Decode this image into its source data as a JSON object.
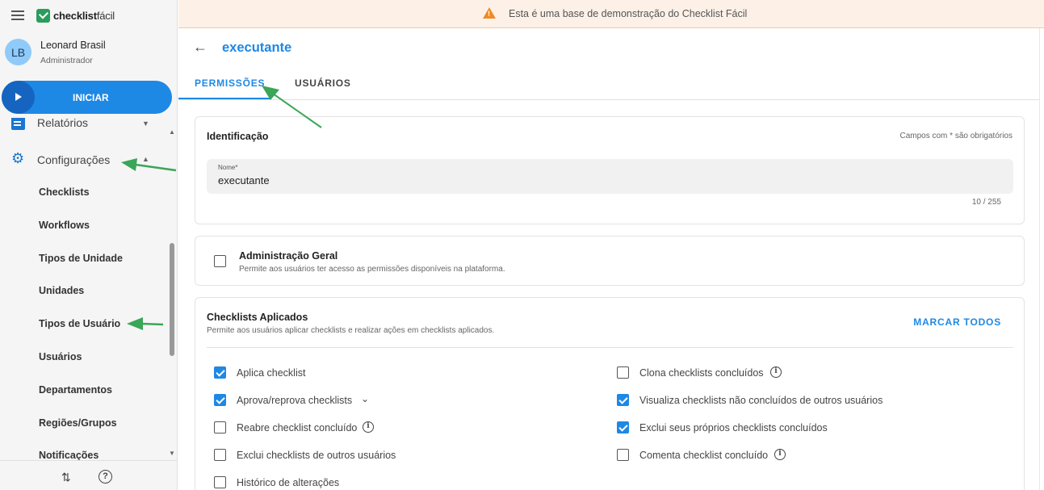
{
  "app": {
    "logo_bold": "checklist",
    "logo_light": "fácil"
  },
  "user": {
    "initials": "LB",
    "name": "Leonard Brasil",
    "role": "Administrador"
  },
  "start_button": {
    "label": "INICIAR"
  },
  "sidebar": {
    "partial_item": "Relatórios",
    "section": "Configurações",
    "items": [
      "Checklists",
      "Workflows",
      "Tipos de Unidade",
      "Unidades",
      "Tipos de Usuário",
      "Usuários",
      "Departamentos",
      "Regiões/Grupos",
      "Notificações"
    ]
  },
  "banner": {
    "text": "Esta é uma base de demonstração do Checklist Fácil"
  },
  "page": {
    "title": "executante"
  },
  "tabs": [
    "PERMISSÕES",
    "USUÁRIOS"
  ],
  "identification": {
    "title": "Identificação",
    "required_note": "Campos com * são obrigatórios",
    "name_label": "Nome*",
    "name_value": "executante",
    "counter": "10 / 255"
  },
  "admin": {
    "title": "Administração Geral",
    "description": "Permite aos usuários ter acesso as permissões disponíveis na plataforma.",
    "checked": false
  },
  "checklists_applied": {
    "title": "Checklists Aplicados",
    "description": "Permite aos usuários aplicar checklists e realizar ações em checklists aplicados.",
    "mark_all": "MARCAR TODOS",
    "left": [
      {
        "label": "Aplica checklist",
        "checked": true
      },
      {
        "label": "Aprova/reprova checklists",
        "checked": true
      },
      {
        "label": "Reabre checklist concluído",
        "checked": false
      },
      {
        "label": "Exclui checklists de outros usuários",
        "checked": false
      },
      {
        "label": "Histórico de alterações",
        "checked": false
      }
    ],
    "right": [
      {
        "label": "Clona checklists concluídos",
        "checked": false
      },
      {
        "label": "Visualiza checklists não concluídos de outros usuários",
        "checked": true
      },
      {
        "label": "Exclui seus próprios checklists concluídos",
        "checked": true
      },
      {
        "label": "Comenta checklist concluído",
        "checked": false
      }
    ]
  },
  "colors": {
    "primary": "#1e88e5",
    "annotation_arrow": "#3aa657",
    "warning": "#f08a24"
  }
}
